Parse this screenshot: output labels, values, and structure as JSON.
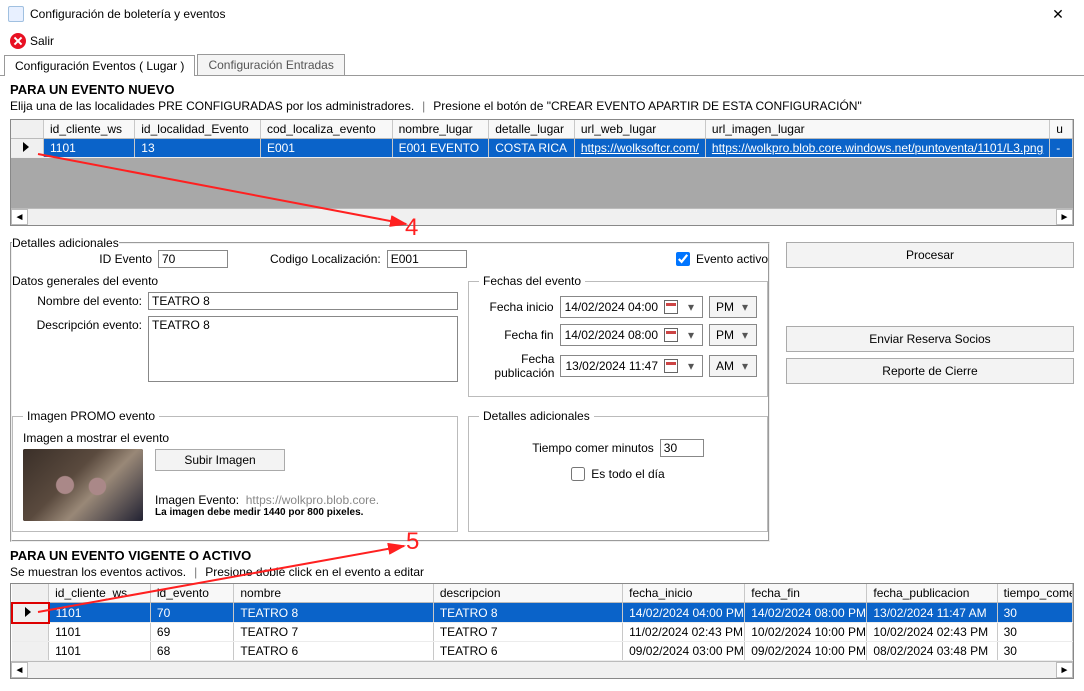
{
  "window": {
    "title": "Configuración de boletería y eventos"
  },
  "toolbar": {
    "salir": "Salir"
  },
  "tabs": {
    "t1": "Configuración Eventos ( Lugar )",
    "t2": "Configuración Entradas"
  },
  "section1": {
    "heading": "PARA UN EVENTO NUEVO",
    "line": "Elija una de las localidades PRE CONFIGURADAS por los administradores.",
    "line2": "Presione el botón de \"CREAR EVENTO APARTIR DE ESTA CONFIGURACIÓN\""
  },
  "grid1": {
    "cols": [
      "id_cliente_ws",
      "id_localidad_Evento",
      "cod_localiza_evento",
      "nombre_lugar",
      "detalle_lugar",
      "url_web_lugar",
      "url_imagen_lugar",
      "u"
    ],
    "row": {
      "id_cliente_ws": "1101",
      "id_localidad_Evento": "13",
      "cod_localiza_evento": "E001",
      "nombre_lugar": "E001 EVENTO",
      "detalle_lugar": "COSTA RICA",
      "url_web_lugar": "https://wolksoftcr.com/",
      "url_imagen_lugar": "https://wolkpro.blob.core.windows.net/puntoventa/1101/L3.png",
      "last": "-"
    }
  },
  "details": {
    "legend": "Detalles adicionales",
    "id_evento_lbl": "ID Evento",
    "id_evento": "70",
    "cod_loc_lbl": "Codigo Localización:",
    "cod_loc": "E001",
    "evento_activo": "Evento activo",
    "datos_generales": "Datos generales del evento",
    "nombre_lbl": "Nombre del evento:",
    "nombre": "TEATRO 8",
    "desc_lbl": "Descripción evento:",
    "desc": "TEATRO 8"
  },
  "fechas": {
    "legend": "Fechas del evento",
    "inicio_lbl": "Fecha inicio",
    "inicio": "14/02/2024 04:00",
    "inicio_ampm": "PM",
    "fin_lbl": "Fecha fin",
    "fin": "14/02/2024 08:00",
    "fin_ampm": "PM",
    "pub_lbl": "Fecha publicación",
    "pub": "13/02/2024 11:47",
    "pub_ampm": "AM"
  },
  "promo": {
    "legend": "Imagen PROMO evento",
    "sub": "Imagen a mostrar el evento",
    "btn": "Subir Imagen",
    "lbl": "Imagen Evento:",
    "url": "https://wolkpro.blob.core.",
    "note": "La imagen debe medir 1440 por 800 pixeles."
  },
  "adic": {
    "legend": "Detalles adicionales",
    "tiempo_lbl": "Tiempo comer minutos",
    "tiempo": "30",
    "allday": "Es todo el día"
  },
  "buttons": {
    "procesar": "Procesar",
    "enviar": "Enviar Reserva Socios",
    "reporte": "Reporte de Cierre"
  },
  "section2": {
    "heading": "PARA UN EVENTO VIGENTE O ACTIVO",
    "line": "Se muestran los eventos activos.",
    "line2": "Presione doble click en el evento a editar"
  },
  "grid2": {
    "cols": [
      "id_cliente_ws",
      "id_evento",
      "nombre",
      "descripcion",
      "fecha_inicio",
      "fecha_fin",
      "fecha_publicacion",
      "tiempo_come"
    ],
    "rows": [
      {
        "id_cliente_ws": "1101",
        "id_evento": "70",
        "nombre": "TEATRO 8",
        "descripcion": "TEATRO 8",
        "fecha_inicio": "14/02/2024 04:00 PM",
        "fecha_fin": "14/02/2024 08:00 PM",
        "fecha_publicacion": "13/02/2024 11:47 AM",
        "tiempo": "30"
      },
      {
        "id_cliente_ws": "1101",
        "id_evento": "69",
        "nombre": "TEATRO 7",
        "descripcion": "TEATRO 7",
        "fecha_inicio": "11/02/2024 02:43 PM",
        "fecha_fin": "10/02/2024 10:00 PM",
        "fecha_publicacion": "10/02/2024 02:43 PM",
        "tiempo": "30"
      },
      {
        "id_cliente_ws": "1101",
        "id_evento": "68",
        "nombre": "TEATRO 6",
        "descripcion": "TEATRO 6",
        "fecha_inicio": "09/02/2024 03:00 PM",
        "fecha_fin": "09/02/2024 10:00 PM",
        "fecha_publicacion": "08/02/2024 03:48 PM",
        "tiempo": "30"
      }
    ]
  },
  "annotations": {
    "a4": "4",
    "a5": "5"
  }
}
